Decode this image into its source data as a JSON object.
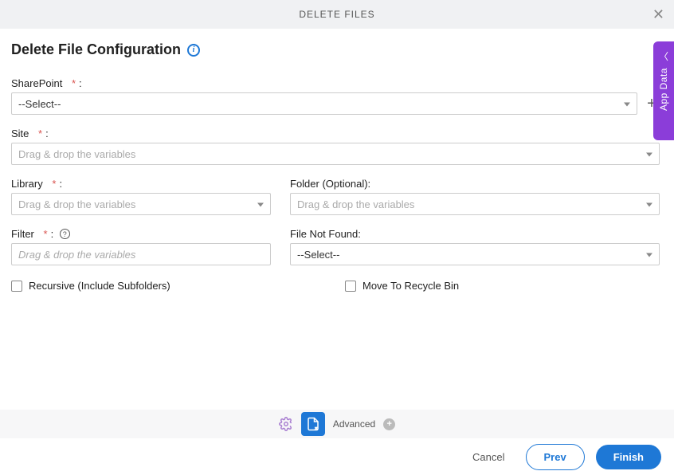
{
  "header": {
    "title": "DELETE FILES"
  },
  "page": {
    "title": "Delete File Configuration"
  },
  "fields": {
    "sharepoint": {
      "label": "SharePoint",
      "value": "--Select--"
    },
    "site": {
      "label": "Site",
      "placeholder": "Drag & drop the variables"
    },
    "library": {
      "label": "Library",
      "placeholder": "Drag & drop the variables"
    },
    "folder": {
      "label": "Folder (Optional):",
      "placeholder": "Drag & drop the variables"
    },
    "filter": {
      "label": "Filter",
      "placeholder": "Drag & drop the variables"
    },
    "fileNotFound": {
      "label": "File Not Found:",
      "value": "--Select--"
    },
    "recursive": {
      "label": "Recursive (Include Subfolders)"
    },
    "recycleBin": {
      "label": "Move To Recycle Bin"
    }
  },
  "toolbar": {
    "advanced": "Advanced"
  },
  "footer": {
    "cancel": "Cancel",
    "prev": "Prev",
    "finish": "Finish"
  },
  "sidepanel": {
    "label": "App Data"
  }
}
